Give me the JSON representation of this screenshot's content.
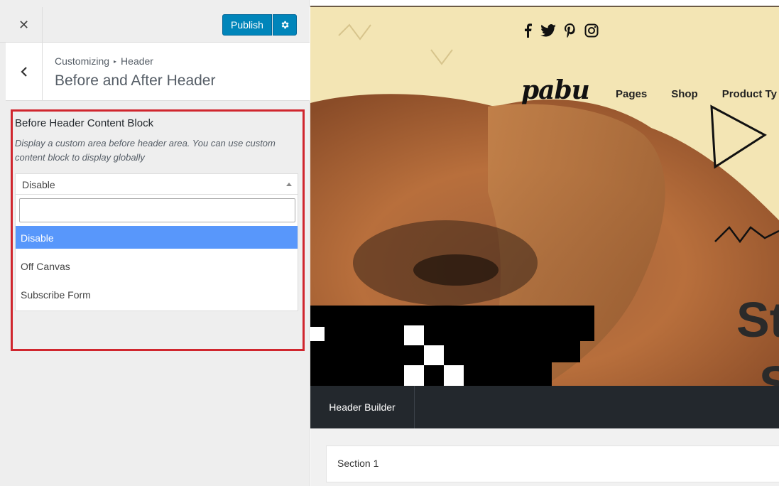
{
  "topbar": {
    "close_symbol": "✕",
    "publish_label": "Publish",
    "gear_icon": "gear-icon",
    "accent": "#0085ba"
  },
  "titlebar": {
    "breadcrumb_root": "Customizing",
    "breadcrumb_sep": "▸",
    "breadcrumb_current": "Header",
    "title": "Before and After Header"
  },
  "control": {
    "label": "Before Header Content Block",
    "description": "Display a custom area before header area. You can use custom content block to display globally",
    "selected": "Disable",
    "search_value": "",
    "options": [
      "Disable",
      "Off Canvas",
      "Subscribe Form"
    ],
    "highlight_color": "#d0262e",
    "option_active_color": "#5897fb"
  },
  "preview": {
    "social_icons": [
      "facebook-icon",
      "twitter-icon",
      "pinterest-icon",
      "instagram-icon"
    ],
    "logo": "pabu",
    "nav": [
      "Pages",
      "Shop",
      "Product Ty"
    ],
    "hero_line1": "St",
    "hero_line2": "S",
    "builder_tab": "Header Builder",
    "section_label": "Section 1"
  }
}
